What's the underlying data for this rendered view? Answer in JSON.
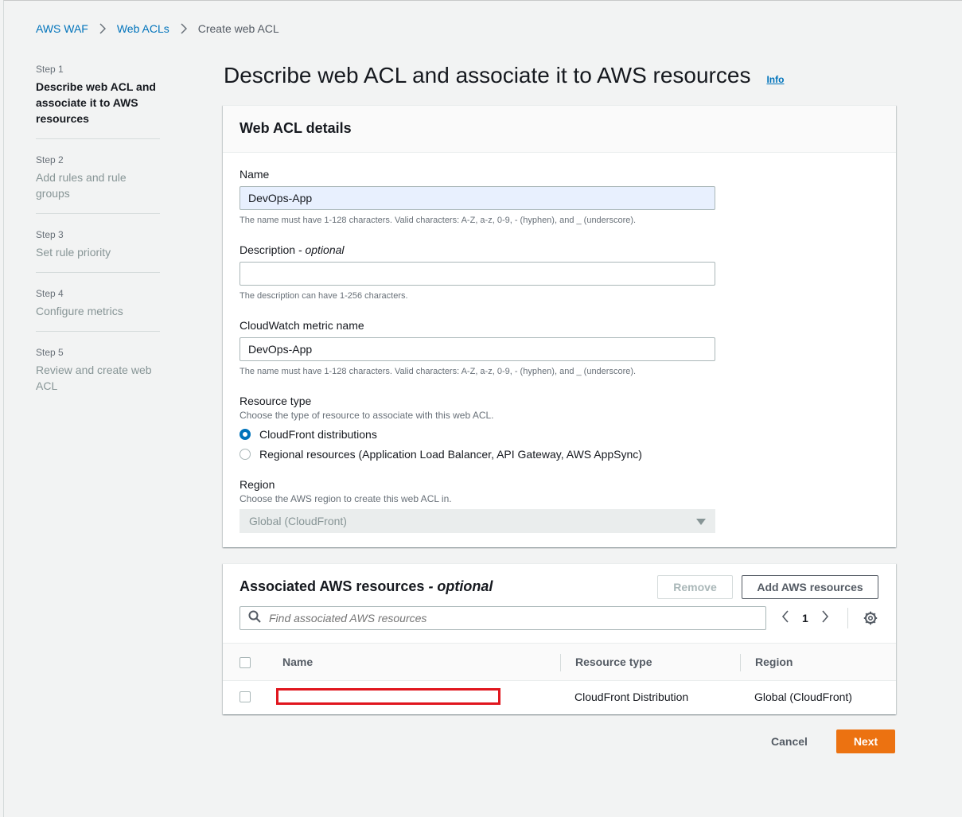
{
  "breadcrumb": {
    "items": [
      "AWS WAF",
      "Web ACLs"
    ],
    "current": "Create web ACL"
  },
  "steps": [
    {
      "num": "Step 1",
      "title": "Describe web ACL and associate it to AWS resources"
    },
    {
      "num": "Step 2",
      "title": "Add rules and rule groups"
    },
    {
      "num": "Step 3",
      "title": "Set rule priority"
    },
    {
      "num": "Step 4",
      "title": "Configure metrics"
    },
    {
      "num": "Step 5",
      "title": "Review and create web ACL"
    }
  ],
  "page": {
    "title": "Describe web ACL and associate it to AWS resources",
    "info": "Info"
  },
  "details": {
    "header": "Web ACL details",
    "name": {
      "label": "Name",
      "value": "DevOps-App",
      "hint": "The name must have 1-128 characters. Valid characters: A-Z, a-z, 0-9, - (hyphen), and _ (underscore)."
    },
    "description": {
      "label": "Description",
      "optional": " - optional",
      "value": "",
      "hint": "The description can have 1-256 characters."
    },
    "metric": {
      "label": "CloudWatch metric name",
      "value": "DevOps-App",
      "hint": "The name must have 1-128 characters. Valid characters: A-Z, a-z, 0-9, - (hyphen), and _ (underscore)."
    },
    "resource_type": {
      "label": "Resource type",
      "sublabel": "Choose the type of resource to associate with this web ACL.",
      "options": [
        {
          "label": "CloudFront distributions",
          "checked": true
        },
        {
          "label": "Regional resources (Application Load Balancer, API Gateway, AWS AppSync)",
          "checked": false
        }
      ]
    },
    "region": {
      "label": "Region",
      "sublabel": "Choose the AWS region to create this web ACL in.",
      "value": "Global (CloudFront)"
    }
  },
  "associated": {
    "title": "Associated AWS resources",
    "optional": " - optional",
    "remove_label": "Remove",
    "add_label": "Add AWS resources",
    "search_placeholder": "Find associated AWS resources",
    "page": "1",
    "columns": [
      "Name",
      "Resource type",
      "Region"
    ],
    "rows": [
      {
        "name": "",
        "type": "CloudFront Distribution",
        "region": "Global (CloudFront)"
      }
    ]
  },
  "actions": {
    "cancel": "Cancel",
    "next": "Next"
  },
  "colors": {
    "link": "#0073bb",
    "primary": "#ec7211",
    "redaction": "#e0161e"
  }
}
